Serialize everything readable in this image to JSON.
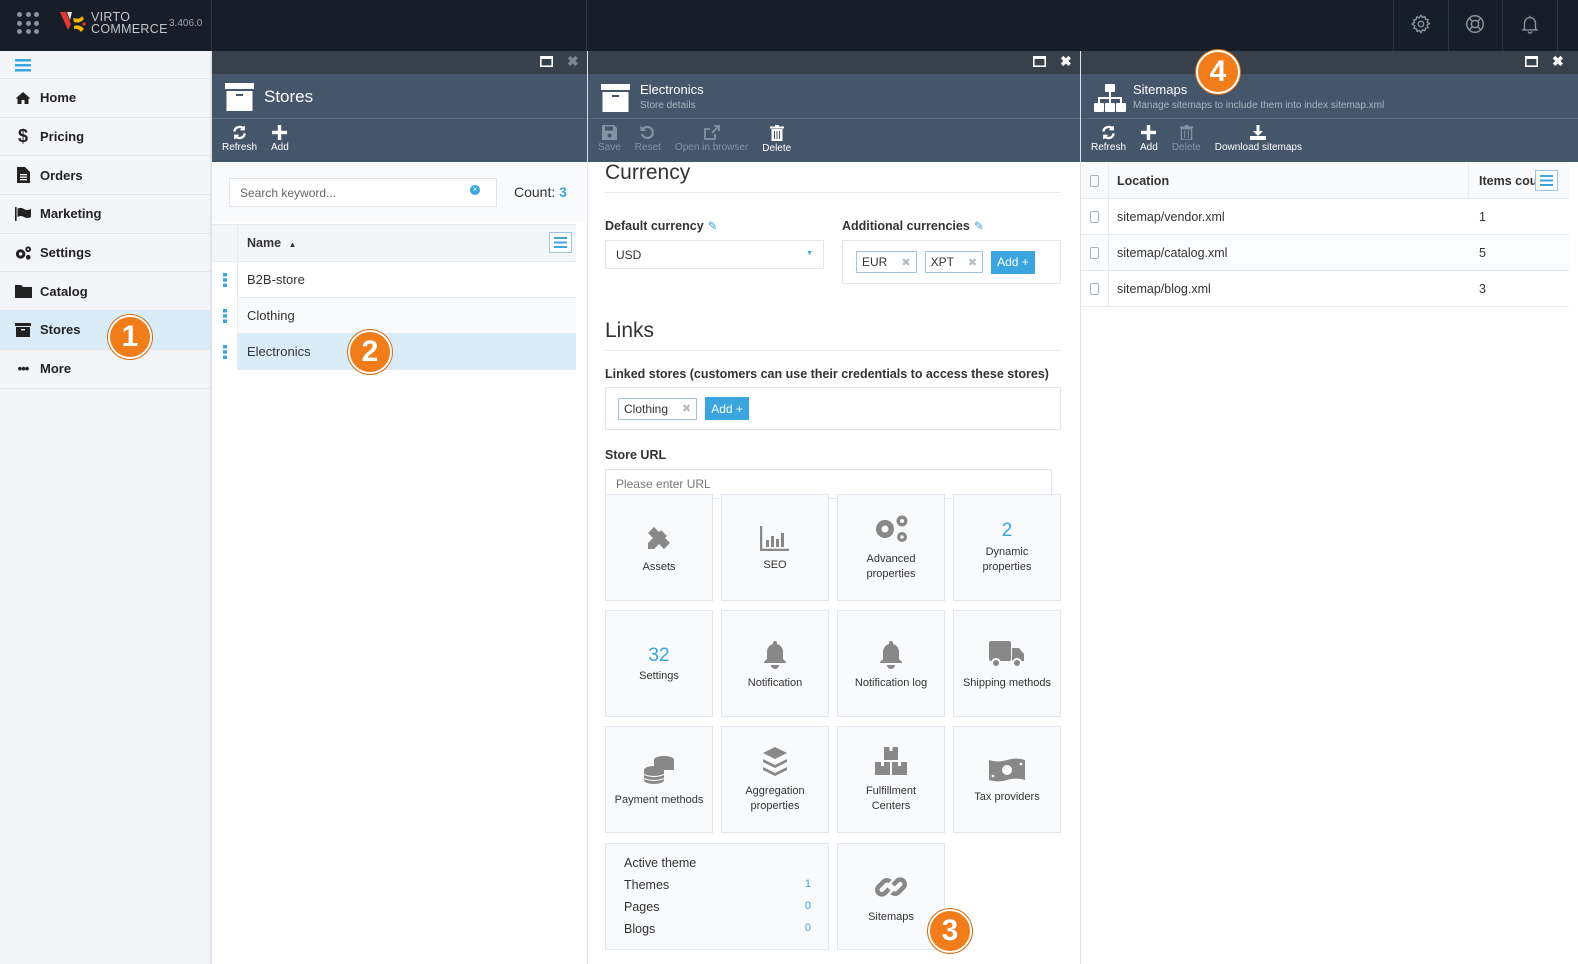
{
  "app": {
    "brand_line1": "VIRTO",
    "brand_line2": "COMMERCE",
    "version": "3.406.0",
    "top_icons": [
      "gear-icon",
      "lifebuoy-icon",
      "bell-icon"
    ]
  },
  "sidebar": {
    "items": [
      {
        "label": "Home",
        "icon": "home-icon"
      },
      {
        "label": "Pricing",
        "icon": "dollar-icon"
      },
      {
        "label": "Orders",
        "icon": "document-icon"
      },
      {
        "label": "Marketing",
        "icon": "flag-icon"
      },
      {
        "label": "Settings",
        "icon": "gears-icon"
      },
      {
        "label": "Catalog",
        "icon": "folder-icon"
      },
      {
        "label": "Stores",
        "icon": "archive-icon",
        "active": true
      },
      {
        "label": "More",
        "icon": "ellipsis-icon"
      }
    ]
  },
  "badges": [
    "1",
    "2",
    "3",
    "4"
  ],
  "stores_blade": {
    "title": "Stores",
    "toolbar": {
      "refresh": "Refresh",
      "add": "Add"
    },
    "search_placeholder": "Search keyword...",
    "count_label": "Count:",
    "count_value": "3",
    "column_name": "Name",
    "rows": [
      "B2B-store",
      "Clothing",
      "Electronics"
    ],
    "selected": "Electronics"
  },
  "store_blade": {
    "title": "Electronics",
    "subtitle": "Store details",
    "toolbar": {
      "save": "Save",
      "reset": "Reset",
      "open": "Open in browser",
      "delete": "Delete"
    },
    "currency_heading": "Currency",
    "default_currency_label": "Default currency",
    "default_currency_value": "USD",
    "additional_currencies_label": "Additional currencies",
    "additional_currencies": [
      "EUR",
      "XPT"
    ],
    "add_label": "Add +",
    "links_heading": "Links",
    "linked_stores_label": "Linked stores (customers can use their credentials to access these stores)",
    "linked_stores": [
      "Clothing"
    ],
    "store_url_label": "Store URL",
    "store_url_placeholder": "Please enter URL",
    "tiles": [
      {
        "label": "Assets",
        "icon": "pencil-ruler-icon"
      },
      {
        "label": "SEO",
        "icon": "bar-chart-icon"
      },
      {
        "label": "Advanced properties",
        "icon": "gears-icon"
      },
      {
        "label": "Dynamic properties",
        "count": "2"
      },
      {
        "label": "Settings",
        "count": "32"
      },
      {
        "label": "Notification",
        "icon": "bell-icon"
      },
      {
        "label": "Notification log",
        "icon": "bell-icon"
      },
      {
        "label": "Shipping methods",
        "icon": "truck-icon"
      },
      {
        "label": "Payment methods",
        "icon": "coins-icon"
      },
      {
        "label": "Aggregation properties",
        "icon": "layers-icon"
      },
      {
        "label": "Fulfillment Centers",
        "icon": "boxes-icon"
      },
      {
        "label": "Tax providers",
        "icon": "money-icon"
      },
      {
        "label": "Sitemaps",
        "icon": "link-icon"
      }
    ],
    "theme_tile": {
      "title": "Active theme",
      "rows": [
        {
          "label": "Themes",
          "value": "1"
        },
        {
          "label": "Pages",
          "value": "0"
        },
        {
          "label": "Blogs",
          "value": "0"
        }
      ]
    }
  },
  "sitemaps_blade": {
    "title": "Sitemaps",
    "subtitle": "Manage sitemaps to include them into index sitemap.xml",
    "toolbar": {
      "refresh": "Refresh",
      "add": "Add",
      "delete": "Delete",
      "download": "Download sitemaps"
    },
    "columns": [
      "Location",
      "Items cou"
    ],
    "rows": [
      {
        "location": "sitemap/vendor.xml",
        "count": "1"
      },
      {
        "location": "sitemap/catalog.xml",
        "count": "5"
      },
      {
        "location": "sitemap/blog.xml",
        "count": "3"
      }
    ]
  }
}
